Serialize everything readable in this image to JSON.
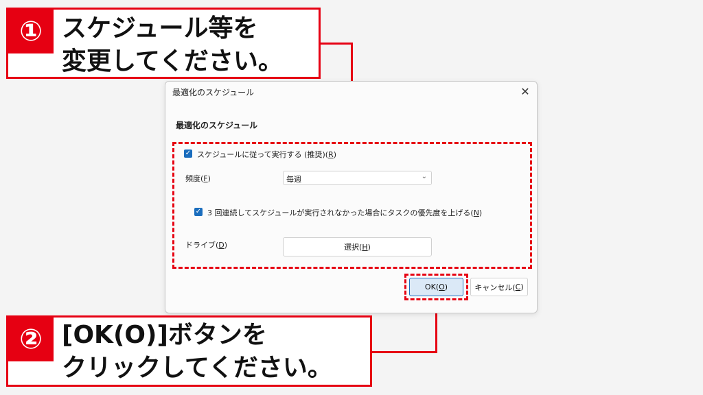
{
  "callout1": {
    "number": "①",
    "line1": "スケジュール等を",
    "line2": "変更してください。"
  },
  "callout2": {
    "number": "②",
    "line1": "[OK(O)]ボタンを",
    "line2": "クリックしてください。"
  },
  "dialog": {
    "title": "最適化のスケジュール",
    "close_icon": "close-icon",
    "heading": "最適化のスケジュール",
    "schedule_checkbox": {
      "checked": true,
      "label": "スケジュールに従って実行する (推奨)(",
      "accel": "R",
      "label_end": ")"
    },
    "frequency": {
      "label": "頻度(",
      "accel": "F",
      "label_end": ")",
      "value": "毎週"
    },
    "notify_checkbox": {
      "checked": true,
      "label": "3 回連続してスケジュールが実行されなかった場合にタスクの優先度を上げる(",
      "accel": "N",
      "label_end": ")"
    },
    "drive": {
      "label": "ドライブ(",
      "accel": "D",
      "label_end": ")",
      "button_label": "選択(",
      "button_accel": "H",
      "button_end": ")"
    },
    "ok_button": {
      "label": "OK(",
      "accel": "O",
      "label_end": ")"
    },
    "cancel_button": {
      "label": "キャンセル(",
      "accel": "C",
      "label_end": ")"
    }
  },
  "colors": {
    "accent_red": "#e60012",
    "checkbox_blue": "#1a6dbd",
    "ok_button_bg": "#dbe9f7"
  }
}
